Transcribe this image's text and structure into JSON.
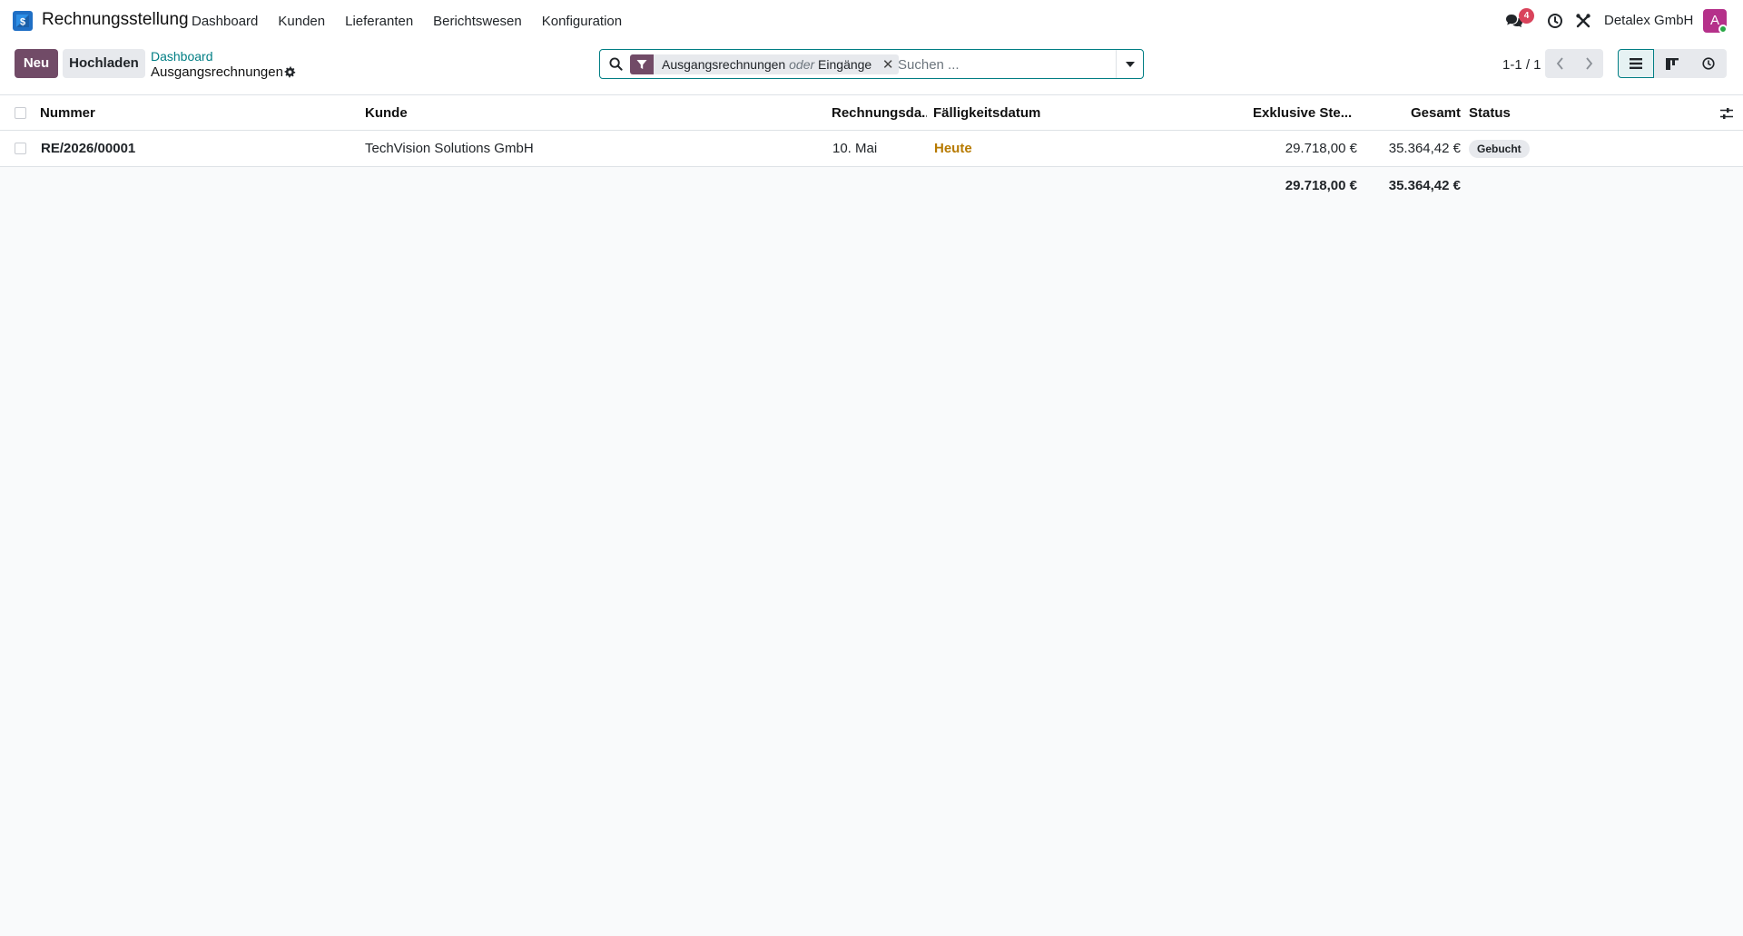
{
  "app": {
    "name": "Rechnungsstellung",
    "logo_color": "#2d7fd0"
  },
  "menu": [
    {
      "label": "Dashboard"
    },
    {
      "label": "Kunden"
    },
    {
      "label": "Lieferanten"
    },
    {
      "label": "Berichtswesen"
    },
    {
      "label": "Konfiguration"
    }
  ],
  "systray": {
    "messages_badge": "4",
    "company": "Detalex GmbH",
    "avatar_letter": "A"
  },
  "control": {
    "new_label": "Neu",
    "upload_label": "Hochladen",
    "breadcrumb_parent": "Dashboard",
    "breadcrumb_current": "Ausgangsrechnungen",
    "search": {
      "facet_value1": "Ausgangsrechnungen",
      "facet_separator": "oder",
      "facet_value2": "Eingänge",
      "placeholder": "Suchen ..."
    },
    "pager": "1-1 / 1"
  },
  "table": {
    "columns": {
      "number": "Nummer",
      "customer": "Kunde",
      "invoice_date": "Rechnungsda...",
      "due_date": "Fälligkeitsdatum",
      "untaxed": "Exklusive Ste...",
      "total": "Gesamt",
      "status": "Status"
    },
    "rows": [
      {
        "number": "RE/2026/00001",
        "customer": "TechVision Solutions GmbH",
        "invoice_date": "10. Mai",
        "due_date": "Heute",
        "untaxed": "29.718,00 €",
        "total": "35.364,42 €",
        "status": "Gebucht"
      }
    ],
    "totals": {
      "untaxed": "29.718,00 €",
      "total": "35.364,42 €"
    }
  },
  "colors": {
    "primary": "#714b67",
    "link": "#017e84",
    "due_warning": "#b77a00",
    "badge": "#d9435b"
  }
}
